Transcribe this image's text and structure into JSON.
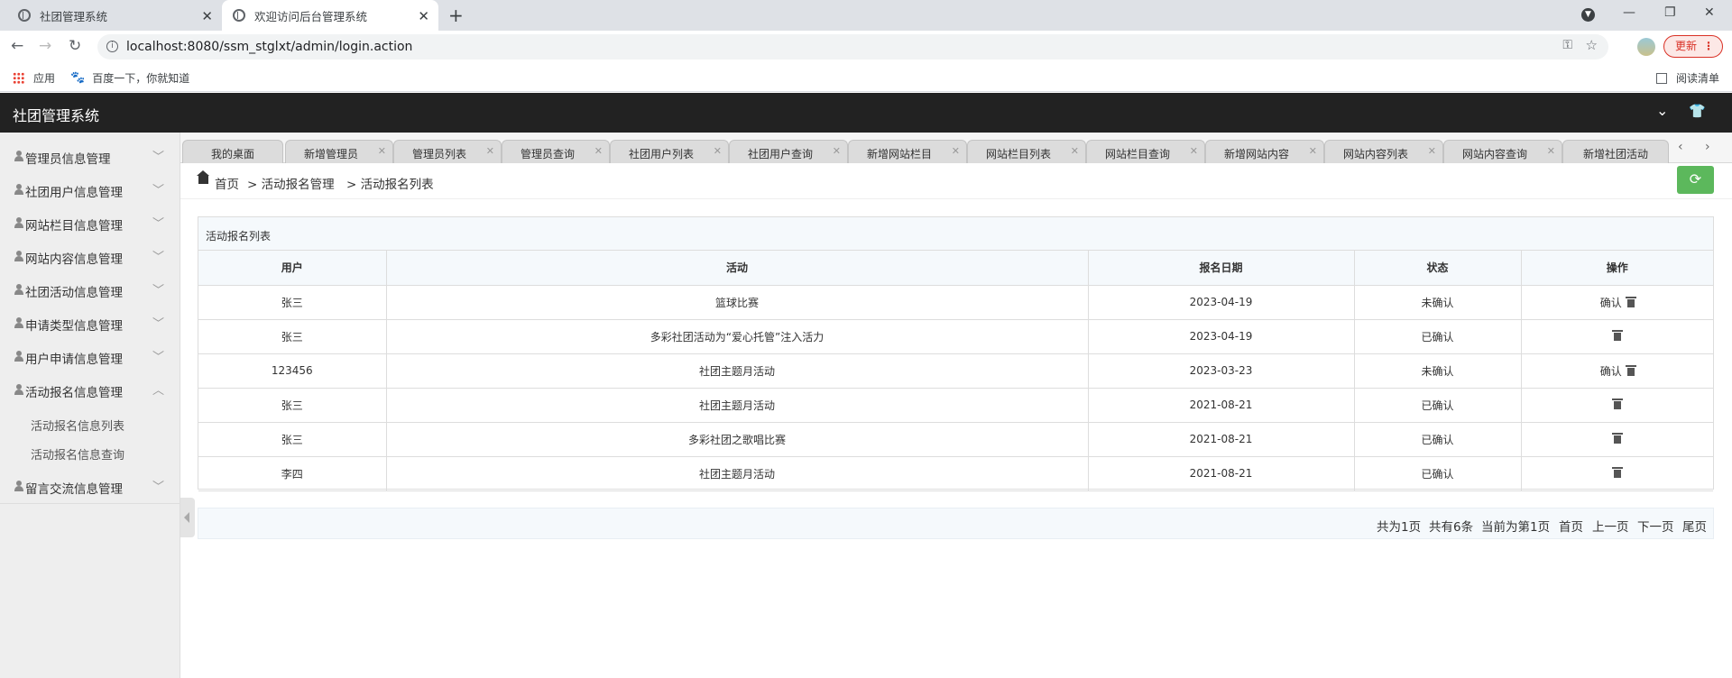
{
  "browser": {
    "tabs": [
      {
        "title": "社团管理系统"
      },
      {
        "title": "欢迎访问后台管理系统"
      }
    ],
    "url": "localhost:8080/ssm_stglxt/admin/login.action",
    "update_label": "更新",
    "bookmarks": [
      {
        "label": "应用"
      },
      {
        "label": "百度一下，你就知道"
      }
    ],
    "reading_list": "阅读清单"
  },
  "header": {
    "title": "社团管理系统"
  },
  "sidebar": {
    "items": [
      {
        "label": "管理员信息管理",
        "expanded": false
      },
      {
        "label": "社团用户信息管理",
        "expanded": false
      },
      {
        "label": "网站栏目信息管理",
        "expanded": false
      },
      {
        "label": "网站内容信息管理",
        "expanded": false
      },
      {
        "label": "社团活动信息管理",
        "expanded": false
      },
      {
        "label": "申请类型信息管理",
        "expanded": false
      },
      {
        "label": "用户申请信息管理",
        "expanded": false
      },
      {
        "label": "活动报名信息管理",
        "expanded": true
      },
      {
        "label": "留言交流信息管理",
        "expanded": false
      }
    ],
    "subitems": [
      {
        "label": "活动报名信息列表"
      },
      {
        "label": "活动报名信息查询"
      }
    ]
  },
  "page_tabs": [
    {
      "label": "我的桌面"
    },
    {
      "label": "新增管理员"
    },
    {
      "label": "管理员列表"
    },
    {
      "label": "管理员查询"
    },
    {
      "label": "社团用户列表"
    },
    {
      "label": "社团用户查询"
    },
    {
      "label": "新增网站栏目"
    },
    {
      "label": "网站栏目列表"
    },
    {
      "label": "网站栏目查询"
    },
    {
      "label": "新增网站内容"
    },
    {
      "label": "网站内容列表"
    },
    {
      "label": "网站内容查询"
    },
    {
      "label": "新增社团活动"
    }
  ],
  "breadcrumb": {
    "home": "首页",
    "level1": "> 活动报名管理",
    "level2": "> 活动报名列表"
  },
  "table": {
    "title": "活动报名列表",
    "columns": [
      "用户",
      "活动",
      "报名日期",
      "状态",
      "操作"
    ],
    "rows": [
      {
        "user": "张三",
        "activity": "篮球比赛",
        "date": "2023-04-19",
        "status": "未确认",
        "confirm": "确认"
      },
      {
        "user": "张三",
        "activity": "多彩社团活动为“爱心托管”注入活力",
        "date": "2023-04-19",
        "status": "已确认",
        "confirm": ""
      },
      {
        "user": "123456",
        "activity": "社团主题月活动",
        "date": "2023-03-23",
        "status": "未确认",
        "confirm": "确认"
      },
      {
        "user": "张三",
        "activity": "社团主题月活动",
        "date": "2021-08-21",
        "status": "已确认",
        "confirm": ""
      },
      {
        "user": "张三",
        "activity": "多彩社团之歌唱比赛",
        "date": "2021-08-21",
        "status": "已确认",
        "confirm": ""
      },
      {
        "user": "李四",
        "activity": "社团主题月活动",
        "date": "2021-08-21",
        "status": "已确认",
        "confirm": ""
      }
    ]
  },
  "pager": {
    "total_pages": "共为1页",
    "total_records": "共有6条",
    "current": "当前为第1页",
    "first": "首页",
    "prev": "上一页",
    "next": "下一页",
    "last": "尾页"
  },
  "colors": {
    "header_bg": "#222222",
    "refresh_btn": "#5cb85c",
    "sidebar_bg": "#eeeeee"
  }
}
